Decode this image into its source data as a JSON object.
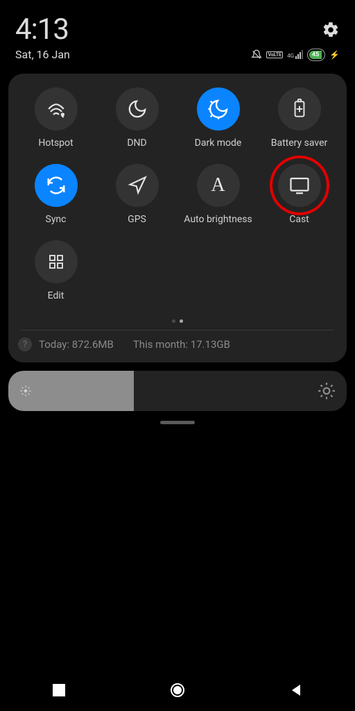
{
  "status": {
    "time": "4:13",
    "date": "Sat, 16 Jan",
    "volte": "VoLTE",
    "signal": "4G",
    "battery_pct": "45",
    "charging": true
  },
  "tiles": [
    {
      "id": "hotspot",
      "label": "Hotspot",
      "active": false
    },
    {
      "id": "dnd",
      "label": "DND",
      "active": false
    },
    {
      "id": "darkmode",
      "label": "Dark mode",
      "active": true
    },
    {
      "id": "battsaver",
      "label": "Battery saver",
      "active": false
    },
    {
      "id": "sync",
      "label": "Sync",
      "active": true
    },
    {
      "id": "gps",
      "label": "GPS",
      "active": false
    },
    {
      "id": "autobright",
      "label": "Auto brightness",
      "active": false
    },
    {
      "id": "cast",
      "label": "Cast",
      "active": false,
      "highlighted": true
    },
    {
      "id": "edit",
      "label": "Edit",
      "active": false
    }
  ],
  "pager": {
    "count": 2,
    "current": 1
  },
  "usage": {
    "today": "Today: 872.6MB",
    "month": "This month: 17.13GB"
  },
  "brightness": {
    "level_pct": 37
  },
  "colors": {
    "accent": "#0a84ff",
    "highlight": "#e20000",
    "panel": "#232323",
    "tile": "#333333"
  }
}
